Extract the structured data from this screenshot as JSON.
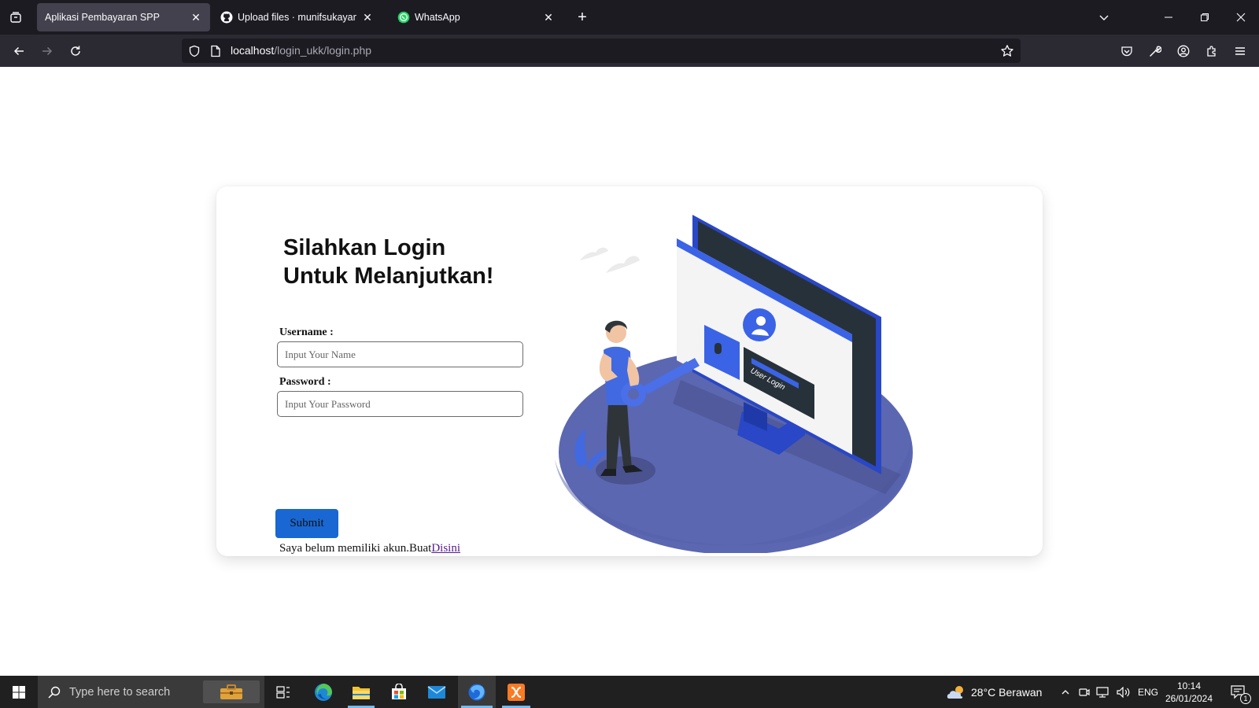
{
  "browser": {
    "tabs": [
      {
        "title": "Aplikasi Pembayaran SPP",
        "active": true
      },
      {
        "title": "Upload files · munifsukayanto/",
        "active": false
      },
      {
        "title": "WhatsApp",
        "active": false
      }
    ],
    "url": {
      "host": "localhost",
      "path": "/login_ukk/login.php"
    }
  },
  "login": {
    "heading": "Silahkan Login Untuk Melanjutkan!",
    "username_label": "Username :",
    "username_placeholder": "Input Your Name",
    "password_label": "Password :",
    "password_placeholder": "Input Your Password",
    "submit_label": "Submit",
    "signup_text": "Saya belum memiliki akun.Buat",
    "signup_link": "Disini"
  },
  "illustration": {
    "screen_label": "User Login"
  },
  "taskbar": {
    "search_placeholder": "Type here to search",
    "weather": "28°C  Berawan",
    "language": "ENG",
    "time": "10:14",
    "date": "26/01/2024",
    "notifications": "1"
  },
  "colors": {
    "accent": "#1967d2",
    "illustration_blue": "#4169e1",
    "platform": "#5b67b0"
  }
}
